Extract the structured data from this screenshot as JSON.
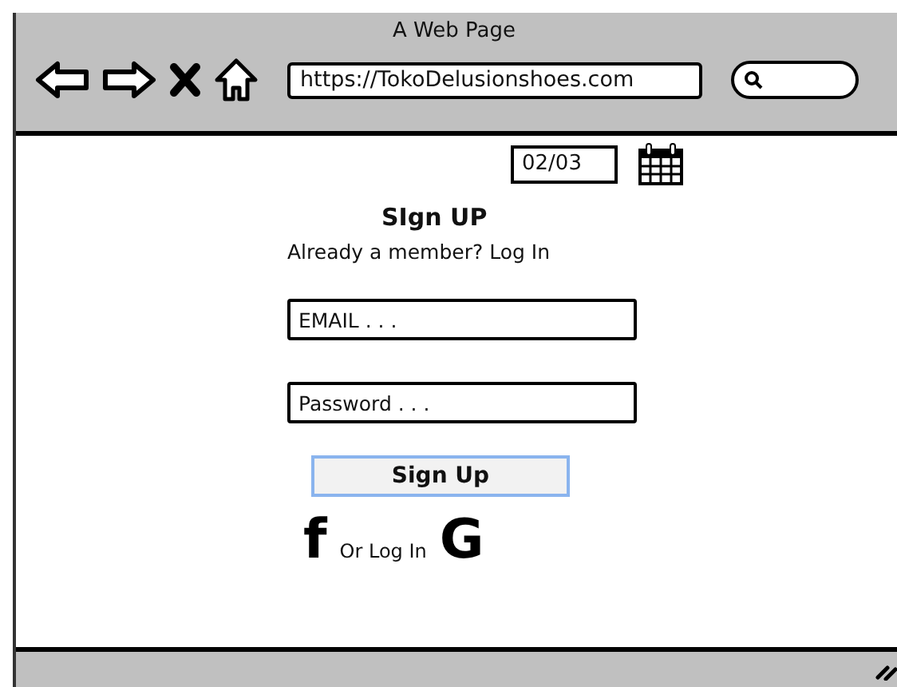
{
  "window": {
    "title": "A Web Page"
  },
  "address_bar": {
    "value": "https://TokoDelusionshoes.com"
  },
  "date_field": {
    "value": "02/03"
  },
  "form": {
    "title": "SIgn UP",
    "subtitle": "Already a member? Log In",
    "fields": [
      {
        "placeholder": "EMAIL . . ."
      },
      {
        "placeholder": "Password . . ."
      }
    ],
    "button": "Sign Up",
    "social": {
      "left": "f",
      "text": "Or Log In",
      "right": "G"
    }
  }
}
